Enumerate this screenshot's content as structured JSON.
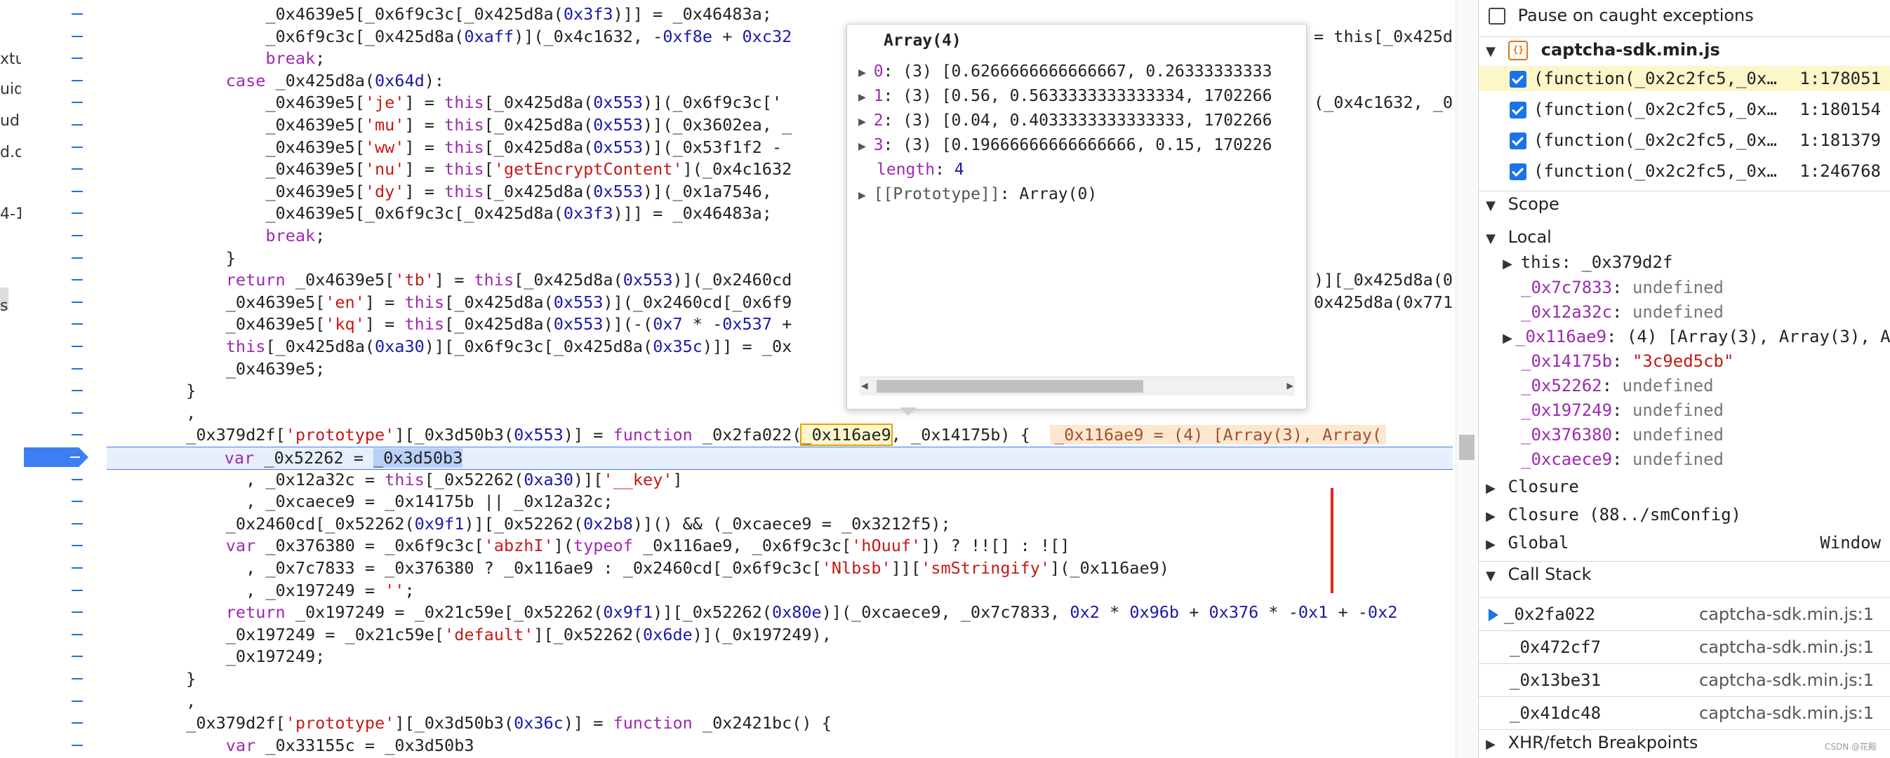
{
  "left_strip": [
    "xtu",
    "uid",
    "ud",
    "d.c",
    "4-1",
    "s"
  ],
  "code_lines": [
    {
      "parts": [
        [
          "",
          "                _0x4639e5[_0x6f9c3c[_0x425d8a("
        ],
        [
          "num",
          "0x3f3"
        ],
        [
          "",
          ")]] = _0x46483a;"
        ]
      ]
    },
    {
      "parts": [
        [
          "",
          "                _0x6f9c3c[_0x425d8a("
        ],
        [
          "num",
          "0xaff"
        ],
        [
          "",
          ")](_0x4c1632, -"
        ],
        [
          "num",
          "0xf8e"
        ],
        [
          "",
          " + "
        ],
        [
          "num",
          "0xc32"
        ]
      ]
    },
    {
      "parts": [
        [
          "kw",
          "                break"
        ],
        [
          "",
          ";"
        ]
      ]
    },
    {
      "parts": [
        [
          "kw",
          "            case"
        ],
        [
          "",
          " _0x425d8a("
        ],
        [
          "num",
          "0x64d"
        ],
        [
          "",
          "):"
        ]
      ]
    },
    {
      "parts": [
        [
          "",
          "                _0x4639e5["
        ],
        [
          "str",
          "'je'"
        ],
        [
          "",
          "] = "
        ],
        [
          "th",
          "this"
        ],
        [
          "",
          "[_0x425d8a("
        ],
        [
          "num",
          "0x553"
        ],
        [
          "",
          ")](_0x6f9c3c['"
        ]
      ]
    },
    {
      "parts": [
        [
          "",
          "                _0x4639e5["
        ],
        [
          "str",
          "'mu'"
        ],
        [
          "",
          "] = "
        ],
        [
          "th",
          "this"
        ],
        [
          "",
          "[_0x425d8a("
        ],
        [
          "num",
          "0x553"
        ],
        [
          "",
          ")](_0x3602ea, _"
        ]
      ]
    },
    {
      "parts": [
        [
          "",
          "                _0x4639e5["
        ],
        [
          "str",
          "'ww'"
        ],
        [
          "",
          "] = "
        ],
        [
          "th",
          "this"
        ],
        [
          "",
          "[_0x425d8a("
        ],
        [
          "num",
          "0x553"
        ],
        [
          "",
          ")](_0x53f1f2 -"
        ]
      ]
    },
    {
      "parts": [
        [
          "",
          "                _0x4639e5["
        ],
        [
          "str",
          "'nu'"
        ],
        [
          "",
          "] = "
        ],
        [
          "th",
          "this"
        ],
        [
          "",
          "["
        ],
        [
          "str",
          "'getEncryptContent'"
        ],
        [
          "",
          "](_0x4c1632"
        ]
      ]
    },
    {
      "parts": [
        [
          "",
          "                _0x4639e5["
        ],
        [
          "str",
          "'dy'"
        ],
        [
          "",
          "] = "
        ],
        [
          "th",
          "this"
        ],
        [
          "",
          "[_0x425d8a("
        ],
        [
          "num",
          "0x553"
        ],
        [
          "",
          ")](_0x1a7546, "
        ]
      ]
    },
    {
      "parts": [
        [
          "",
          "                _0x4639e5[_0x6f9c3c[_0x425d8a("
        ],
        [
          "num",
          "0x3f3"
        ],
        [
          "",
          ")]] = _0x46483a;"
        ]
      ]
    },
    {
      "parts": [
        [
          "kw",
          "                break"
        ],
        [
          "",
          ";"
        ]
      ]
    },
    {
      "parts": [
        [
          "",
          "            }"
        ]
      ]
    },
    {
      "parts": [
        [
          "kw",
          "            return"
        ],
        [
          "",
          " _0x4639e5["
        ],
        [
          "str",
          "'tb'"
        ],
        [
          "",
          "] = "
        ],
        [
          "th",
          "this"
        ],
        [
          "",
          "[_0x425d8a("
        ],
        [
          "num",
          "0x553"
        ],
        [
          "",
          ")](_0x2460cd"
        ]
      ]
    },
    {
      "parts": [
        [
          "",
          "            _0x4639e5["
        ],
        [
          "str",
          "'en'"
        ],
        [
          "",
          "] = "
        ],
        [
          "th",
          "this"
        ],
        [
          "",
          "[_0x425d8a("
        ],
        [
          "num",
          "0x553"
        ],
        [
          "",
          ")](_0x2460cd[_0x6f9"
        ]
      ]
    },
    {
      "parts": [
        [
          "",
          "            _0x4639e5["
        ],
        [
          "str",
          "'kq'"
        ],
        [
          "",
          "] = "
        ],
        [
          "th",
          "this"
        ],
        [
          "",
          "[_0x425d8a("
        ],
        [
          "num",
          "0x553"
        ],
        [
          "",
          ")](-("
        ],
        [
          "num",
          "0x7"
        ],
        [
          "",
          " * -"
        ],
        [
          "num",
          "0x537"
        ],
        [
          "",
          " +"
        ]
      ]
    },
    {
      "parts": [
        [
          "th",
          "            this"
        ],
        [
          "",
          "[_0x425d8a("
        ],
        [
          "num",
          "0xa30"
        ],
        [
          "",
          ")][_0x6f9c3c[_0x425d8a("
        ],
        [
          "num",
          "0x35c"
        ],
        [
          "",
          ")]] = _0x"
        ]
      ]
    },
    {
      "parts": [
        [
          "",
          "            _0x4639e5;"
        ]
      ]
    },
    {
      "parts": [
        [
          "",
          "        }"
        ]
      ]
    },
    {
      "parts": [
        [
          "",
          "        ,"
        ]
      ]
    },
    {
      "parts": [
        [
          "",
          "        _0x379d2f["
        ],
        [
          "str",
          "'prototype'"
        ],
        [
          "",
          "][_0x3d50b3("
        ],
        [
          "num",
          "0x553"
        ],
        [
          "",
          ")] = "
        ],
        [
          "kw",
          "function"
        ],
        [
          "",
          " _0x2fa022("
        ],
        [
          "boxed",
          "_0x116ae9"
        ],
        [
          "",
          ", _0x14175b) {  "
        ],
        [
          "inline",
          "_0x116ae9 = (4) [Array(3), Array("
        ]
      ]
    },
    {
      "exec": true,
      "parts": [
        [
          "kw",
          "            var"
        ],
        [
          "",
          " _0x52262 = "
        ],
        [
          "hl",
          "_0x3d50b3"
        ]
      ]
    },
    {
      "parts": [
        [
          "",
          "              , _0x12a32c = "
        ],
        [
          "th",
          "this"
        ],
        [
          "",
          "[_0x52262("
        ],
        [
          "num",
          "0xa30"
        ],
        [
          "",
          ")]["
        ],
        [
          "str",
          "'__key'"
        ],
        [
          "",
          "]"
        ]
      ]
    },
    {
      "parts": [
        [
          "",
          "              , _0xcaece9 = _0x14175b || _0x12a32c;"
        ]
      ]
    },
    {
      "parts": [
        [
          "",
          "            _0x2460cd[_0x52262("
        ],
        [
          "num",
          "0x9f1"
        ],
        [
          "",
          ")][_0x52262("
        ],
        [
          "num",
          "0x2b8"
        ],
        [
          "",
          ")]() && (_0xcaece9 = _0x3212f5);"
        ]
      ]
    },
    {
      "parts": [
        [
          "kw",
          "            var"
        ],
        [
          "",
          " _0x376380 = _0x6f9c3c["
        ],
        [
          "str",
          "'abzhI'"
        ],
        [
          "",
          "]("
        ],
        [
          "kw",
          "typeof"
        ],
        [
          "",
          " _0x116ae9, _0x6f9c3c["
        ],
        [
          "str",
          "'hOuuf'"
        ],
        [
          "",
          "]) ? !![] : ![]"
        ]
      ]
    },
    {
      "parts": [
        [
          "",
          "              , _0x7c7833 = _0x376380 ? _0x116ae9 : _0x2460cd[_0x6f9c3c["
        ],
        [
          "str",
          "'Nlbsb'"
        ],
        [
          "",
          "]]["
        ],
        [
          "str",
          "'smStringify'"
        ],
        [
          "",
          "](_0x116ae9)"
        ]
      ]
    },
    {
      "parts": [
        [
          "",
          "              , _0x197249 = "
        ],
        [
          "str",
          "''"
        ],
        [
          "",
          ";"
        ]
      ]
    },
    {
      "parts": [
        [
          "kw",
          "            return"
        ],
        [
          "",
          " _0x197249 = _0x21c59e[_0x52262("
        ],
        [
          "num",
          "0x9f1"
        ],
        [
          "",
          ")][_0x52262("
        ],
        [
          "num",
          "0x80e"
        ],
        [
          "",
          ")](_0xcaece9, _0x7c7833, "
        ],
        [
          "num",
          "0x2"
        ],
        [
          "",
          " * "
        ],
        [
          "num",
          "0x96b"
        ],
        [
          "",
          " + "
        ],
        [
          "num",
          "0x376"
        ],
        [
          "",
          " * -"
        ],
        [
          "num",
          "0x1"
        ],
        [
          "",
          " + -"
        ],
        [
          "num",
          "0x2"
        ]
      ]
    },
    {
      "parts": [
        [
          "",
          "            _0x197249 = _0x21c59e["
        ],
        [
          "str",
          "'default'"
        ],
        [
          "",
          "][_0x52262("
        ],
        [
          "num",
          "0x6de"
        ],
        [
          "",
          ")](_0x197249),"
        ]
      ]
    },
    {
      "parts": [
        [
          "",
          "            _0x197249;"
        ]
      ]
    },
    {
      "parts": [
        [
          "",
          "        }"
        ]
      ]
    },
    {
      "parts": [
        [
          "",
          "        ,"
        ]
      ]
    },
    {
      "parts": [
        [
          "",
          "        _0x379d2f["
        ],
        [
          "str",
          "'prototype'"
        ],
        [
          "",
          "][_0x3d50b3("
        ],
        [
          "num",
          "0x36c"
        ],
        [
          "",
          ")] = "
        ],
        [
          "kw",
          "function"
        ],
        [
          "",
          " _0x2421bc() {"
        ]
      ]
    },
    {
      "parts": [
        [
          "kw",
          "            var"
        ],
        [
          "",
          " _0x33155c = _0x3d50b3"
        ]
      ]
    }
  ],
  "right_code_fragments": [
    {
      "line": 1,
      "text": "= this[_0x425d"
    },
    {
      "line": 4,
      "text": "(_0x4c1632, _0"
    },
    {
      "line": 12,
      "text": ")][_0x425d8a(0"
    },
    {
      "line": 13,
      "text": "0x425d8a(0x771"
    }
  ],
  "popup": {
    "title": "Array(4)",
    "rows": [
      {
        "key": "0",
        "value": "(3) [0.6266666666666667, 0.26333333333"
      },
      {
        "key": "1",
        "value": "(3) [0.56, 0.5633333333333334, 1702266"
      },
      {
        "key": "2",
        "value": "(3) [0.04, 0.4033333333333333, 1702266"
      },
      {
        "key": "3",
        "value": "(3) [0.19666666666666666, 0.15, 170226"
      }
    ],
    "length_label": "length",
    "length_value": "4",
    "prototype_label": "[[Prototype]]",
    "prototype_value": "Array(0)"
  },
  "sidebar": {
    "pause_caught": "Pause on caught exceptions",
    "file_name": "captcha-sdk.min.js",
    "breakpoints": [
      {
        "code": "(function(_0x2c2fc5,_0x…",
        "loc": "1:178051",
        "selected": true
      },
      {
        "code": "(function(_0x2c2fc5,_0x…",
        "loc": "1:180154",
        "selected": false
      },
      {
        "code": "(function(_0x2c2fc5,_0x…",
        "loc": "1:181379",
        "selected": false
      },
      {
        "code": "(function(_0x2c2fc5,_0x…",
        "loc": "1:246768",
        "selected": false
      }
    ],
    "scope_title": "Scope",
    "local_title": "Local",
    "this_label": "this",
    "this_value": "_0x379d2f",
    "locals": [
      {
        "name": "_0x7c7833",
        "value": "undefined",
        "kind": "undef"
      },
      {
        "name": "_0x12a32c",
        "value": "undefined",
        "kind": "undef"
      },
      {
        "name": "_0x116ae9",
        "value": "(4) [Array(3), Array(3), A",
        "kind": "obj",
        "expandable": true
      },
      {
        "name": "_0x14175b",
        "value": "\"3c9ed5cb\"",
        "kind": "str"
      },
      {
        "name": "_0x52262",
        "value": "undefined",
        "kind": "undef"
      },
      {
        "name": "_0x197249",
        "value": "undefined",
        "kind": "undef"
      },
      {
        "name": "_0x376380",
        "value": "undefined",
        "kind": "undef"
      },
      {
        "name": "_0xcaece9",
        "value": "undefined",
        "kind": "undef"
      }
    ],
    "closure1": "Closure",
    "closure2": "Closure (88../smConfig)",
    "global_label": "Global",
    "global_value": "Window",
    "call_stack_title": "Call Stack",
    "stack": [
      {
        "fn": "_0x2fa022",
        "file": "captcha-sdk.min.js:1",
        "current": true
      },
      {
        "fn": "_0x472cf7",
        "file": "captcha-sdk.min.js:1",
        "current": false
      },
      {
        "fn": "_0x13be31",
        "file": "captcha-sdk.min.js:1",
        "current": false
      },
      {
        "fn": "_0x41dc48",
        "file": "captcha-sdk.min.js:1",
        "current": false
      }
    ],
    "xhr_title": "XHR/fetch Breakpoints",
    "watermark": "CSDN @花殿"
  }
}
